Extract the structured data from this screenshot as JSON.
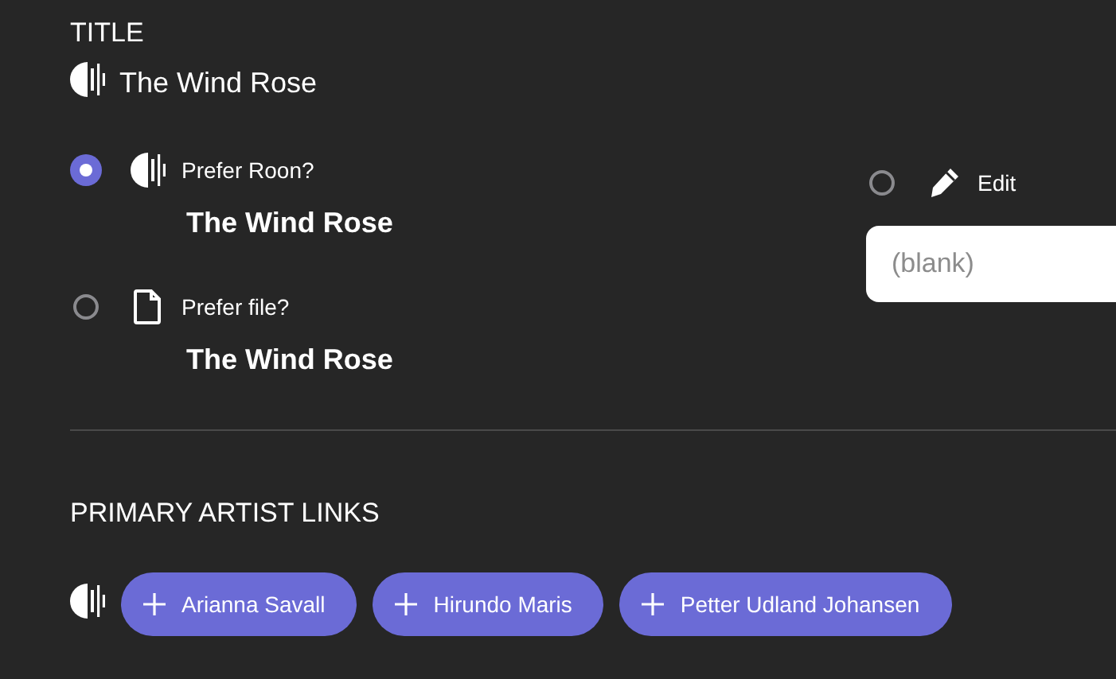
{
  "title_section": {
    "heading": "TITLE",
    "current": {
      "kind": "roon",
      "value": "The Wind Rose"
    },
    "options": [
      {
        "kind": "roon",
        "label": "Prefer Roon?",
        "value": "The Wind Rose",
        "selected": true
      },
      {
        "kind": "file",
        "label": "Prefer file?",
        "value": "The Wind Rose",
        "selected": false
      }
    ],
    "edit_option": {
      "label": "Edit",
      "selected": false,
      "placeholder": "(blank)"
    }
  },
  "artist_section": {
    "heading": "PRIMARY ARTIST LINKS",
    "kind": "roon",
    "artists": [
      {
        "name": "Arianna Savall"
      },
      {
        "name": "Hirundo Maris"
      },
      {
        "name": "Petter Udland Johansen"
      }
    ]
  }
}
